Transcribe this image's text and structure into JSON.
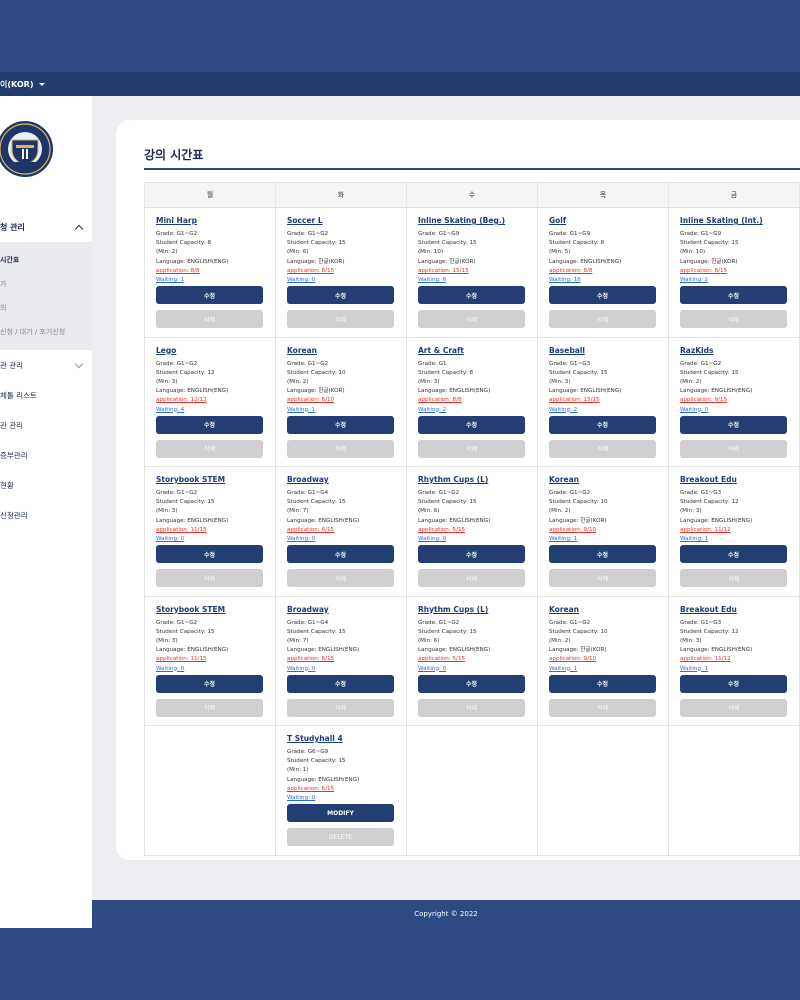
{
  "topbar": {
    "lang_label": "이(KOR)"
  },
  "sidebar": {
    "section_label": "청 관리",
    "sub_items": [
      "시간표",
      "가",
      "의",
      "신청 / 대기 / 포기신청"
    ],
    "items": [
      {
        "label": "관 관리",
        "chevron": true
      },
      {
        "label": "체틀 리스트",
        "chevron": false
      },
      {
        "label": "관 관리",
        "chevron": false
      },
      {
        "label": "증부관리",
        "chevron": false
      },
      {
        "label": "현황",
        "chevron": false
      },
      {
        "label": "신청관리",
        "chevron": false
      }
    ]
  },
  "page_title": "강의 시간표",
  "days": [
    "월",
    "화",
    "수",
    "목",
    "금"
  ],
  "buttons": {
    "modify_kr": "수정",
    "delete_kr": "삭제",
    "modify_en": "MODIFY",
    "delete_en": "DELETE"
  },
  "rows": [
    [
      {
        "title": "Mini Harp",
        "grade": "Grade: G1~G2",
        "capacity": "Student Capacity: 8",
        "min": "(Min: 2)",
        "lang": "Language: ENGLISH(ENG)",
        "app": "application: 8/8",
        "wait": "Waiting: 1"
      },
      {
        "title": "Soccer L",
        "grade": "Grade: G1~G2",
        "capacity": "Student Capacity: 15",
        "min": "(Min: 6)",
        "lang": "Language: 한글(KOR)",
        "app": "application: 8/15",
        "wait": "Waiting: 0"
      },
      {
        "title": "Inline Skating (Beg.)",
        "grade": "Grade: G1~G9",
        "capacity": "Student Capacity: 15",
        "min": "(Min: 10)",
        "lang": "Language: 한글(KOR)",
        "app": "application: 15/15",
        "wait": "Waiting: 6"
      },
      {
        "title": "Golf",
        "grade": "Grade: G1~G9",
        "capacity": "Student Capacity: 8",
        "min": "(Min: 5)",
        "lang": "Language: ENGLISH(ENG)",
        "app": "application: 8/8",
        "wait": "Waiting: 16"
      },
      {
        "title": "Inline Skating (Int.)",
        "grade": "Grade: G1~G9",
        "capacity": "Student Capacity: 15",
        "min": "(Min: 10)",
        "lang": "Language: 한글(KOR)",
        "app": "application: 8/15",
        "wait": "Waiting: 2"
      }
    ],
    [
      {
        "title": "Lego",
        "grade": "Grade: G1~G2",
        "capacity": "Student Capacity: 12",
        "min": "(Min: 3)",
        "lang": "Language: ENGLISH(ENG)",
        "app": "application: 12/12",
        "wait": "Waiting: 4"
      },
      {
        "title": "Korean",
        "grade": "Grade: G1~G2",
        "capacity": "Student Capacity: 10",
        "min": "(Min: 2)",
        "lang": "Language: 한글(KOR)",
        "app": "application: 6/10",
        "wait": "Waiting: 1"
      },
      {
        "title": "Art & Craft",
        "grade": "Grade: G1",
        "capacity": "Student Capacity: 8",
        "min": "(Min: 3)",
        "lang": "Language: ENGLISH(ENG)",
        "app": "application: 8/8",
        "wait": "Waiting: 2"
      },
      {
        "title": "Baseball",
        "grade": "Grade: G1~G3",
        "capacity": "Student Capacity: 15",
        "min": "(Min: 3)",
        "lang": "Language: ENGLISH(ENG)",
        "app": "application: 15/15",
        "wait": "Waiting: 2"
      },
      {
        "title": "RazKids",
        "grade": "Grade: G1~G2",
        "capacity": "Student Capacity: 15",
        "min": "(Min: 2)",
        "lang": "Language: ENGLISH(ENG)",
        "app": "application: 9/15",
        "wait": "Waiting: 0"
      }
    ],
    [
      {
        "title": "Storybook STEM",
        "grade": "Grade: G1~G2",
        "capacity": "Student Capacity: 15",
        "min": "(Min: 3)",
        "lang": "Language: ENGLISH(ENG)",
        "app": "application: 11/15",
        "wait": "Waiting: 0"
      },
      {
        "title": "Broadway",
        "grade": "Grade: G1~G4",
        "capacity": "Student Capacity: 15",
        "min": "(Min: 7)",
        "lang": "Language: ENGLISH(ENG)",
        "app": "application: 6/15",
        "wait": "Waiting: 0"
      },
      {
        "title": "Rhythm Cups (L)",
        "grade": "Grade: G1~G2",
        "capacity": "Student Capacity: 15",
        "min": "(Min: 6)",
        "lang": "Language: ENGLISH(ENG)",
        "app": "application: 5/15",
        "wait": "Waiting: 0"
      },
      {
        "title": "Korean",
        "grade": "Grade: G1~G2",
        "capacity": "Student Capacity: 10",
        "min": "(Min: 2)",
        "lang": "Language: 한글(KOR)",
        "app": "application: 9/10",
        "wait": "Waiting: 1"
      },
      {
        "title": "Breakout Edu",
        "grade": "Grade: G1~G3",
        "capacity": "Student Capacity: 12",
        "min": "(Min: 3)",
        "lang": "Language: ENGLISH(ENG)",
        "app": "application: 11/12",
        "wait": "Waiting: 1"
      }
    ],
    [
      {
        "title": "Storybook STEM",
        "grade": "Grade: G1~G2",
        "capacity": "Student Capacity: 15",
        "min": "(Min: 3)",
        "lang": "Language: ENGLISH(ENG)",
        "app": "application: 11/15",
        "wait": "Waiting: 0"
      },
      {
        "title": "Broadway",
        "grade": "Grade: G1~G4",
        "capacity": "Student Capacity: 15",
        "min": "(Min: 7)",
        "lang": "Language: ENGLISH(ENG)",
        "app": "application: 6/15",
        "wait": "Waiting: 0"
      },
      {
        "title": "Rhythm Cups (L)",
        "grade": "Grade: G1~G2",
        "capacity": "Student Capacity: 15",
        "min": "(Min: 6)",
        "lang": "Language: ENGLISH(ENG)",
        "app": "application: 5/15",
        "wait": "Waiting: 0"
      },
      {
        "title": "Korean",
        "grade": "Grade: G1~G2",
        "capacity": "Student Capacity: 10",
        "min": "(Min: 2)",
        "lang": "Language: 한글(KOR)",
        "app": "application: 9/10",
        "wait": "Waiting: 1"
      },
      {
        "title": "Breakout Edu",
        "grade": "Grade: G1~G3",
        "capacity": "Student Capacity: 12",
        "min": "(Min: 3)",
        "lang": "Language: ENGLISH(ENG)",
        "app": "application: 11/12",
        "wait": "Waiting: 1"
      }
    ],
    [
      null,
      {
        "title": "T Studyhall 4",
        "grade": "Grade: G6~G9",
        "capacity": "Student Capacity: 15",
        "min": "(Min: 1)",
        "lang": "Language: ENGLISH(ENG)",
        "app": "application: 6/15",
        "wait": "Waiting: 0",
        "english_buttons": true
      },
      null,
      null,
      null
    ]
  ],
  "footer": {
    "copyright": "Copyright © 2022"
  }
}
